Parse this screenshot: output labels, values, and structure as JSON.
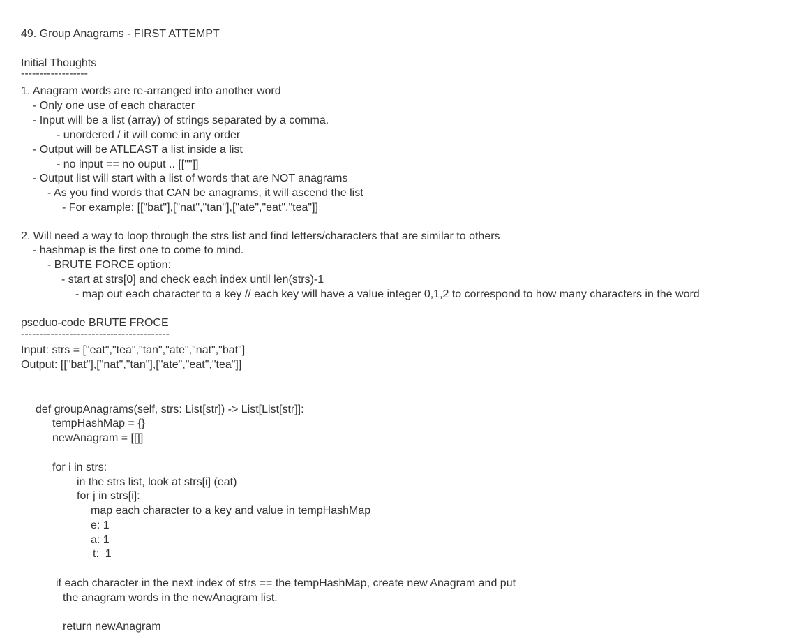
{
  "document": {
    "title": "49. Group Anagrams - FIRST ATTEMPT",
    "section1": {
      "heading": "Initial Thoughts",
      "rule": "------------------",
      "lines": [
        "1. Anagram words are re-arranged into another word",
        "- Only one use of each character",
        "- Input will be a list (array) of strings separated by a comma.",
        "- unordered / it will come in any order",
        "- Output will be ATLEAST a list inside a list",
        "- no input == no ouput .. [[\"\"]]",
        "- Output list will start with a list of words that are NOT anagrams",
        "- As you find words that CAN be anagrams, it will ascend the list",
        "- For example: [[\"bat\"],[\"nat\",\"tan\"],[\"ate\",\"eat\",\"tea\"]]",
        "2. Will need a way to loop through the strs list and find letters/characters that are similar to others",
        "- hashmap is the first one to come to mind.",
        "- BRUTE FORCE option:",
        "- start at strs[0] and check each index until len(strs)-1",
        "- map out each character to a key // each key will have a value integer 0,1,2 to correspond to how many characters in the word"
      ]
    },
    "section2": {
      "heading": "pseduo-code BRUTE FROCE",
      "rule": "----------------------------------------",
      "lines": [
        "Input: strs = [\"eat\",\"tea\",\"tan\",\"ate\",\"nat\",\"bat\"]",
        "Output: [[\"bat\"],[\"nat\",\"tan\"],[\"ate\",\"eat\",\"tea\"]]"
      ]
    },
    "code": [
      "def groupAnagrams(self, strs: List[str]) -> List[List[str]]:",
      "tempHashMap = {}",
      "newAnagram = [[]]",
      "for i in strs:",
      "in the strs list, look at strs[i] (eat)",
      "for j in strs[i]:",
      "map each character to a key and value in tempHashMap",
      "e: 1",
      "a: 1",
      "t:  1",
      "if each character in the next index of strs == the tempHashMap, create new Anagram and put",
      "the anagram words in the newAnagram list.",
      "return newAnagram"
    ]
  }
}
